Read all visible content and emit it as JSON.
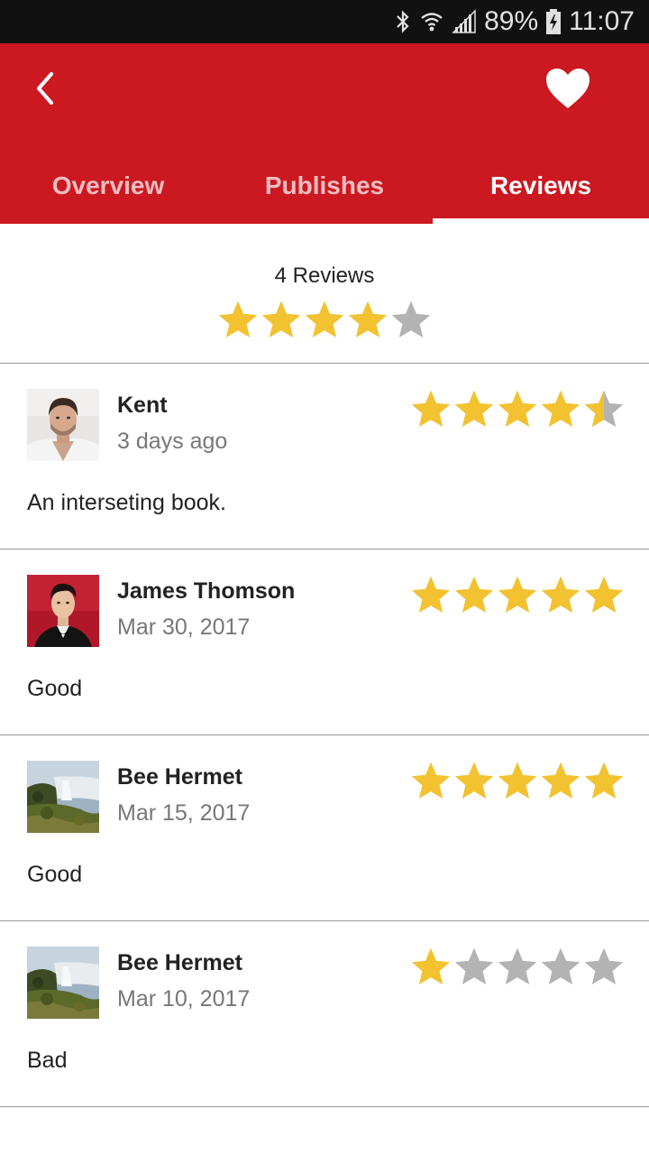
{
  "status_bar": {
    "battery": "89%",
    "time": "11:07"
  },
  "app_bar": {
    "back_icon": "chevron-left-icon",
    "favorite_icon": "heart-icon"
  },
  "tabs": [
    {
      "label": "Overview",
      "active": false
    },
    {
      "label": "Publishes",
      "active": false
    },
    {
      "label": "Reviews",
      "active": true
    }
  ],
  "summary": {
    "count_label": "4 Reviews",
    "rating": 4
  },
  "reviews": [
    {
      "name": "Kent",
      "date": "3 days ago",
      "text": "An interseting book.",
      "rating": 4.5,
      "avatar": "portrait-man"
    },
    {
      "name": "James Thomson",
      "date": "Mar 30, 2017",
      "text": "Good",
      "rating": 5,
      "avatar": "portrait-tuxedo"
    },
    {
      "name": "Bee Hermet",
      "date": "Mar 15, 2017",
      "text": "Good",
      "rating": 5,
      "avatar": "waterfall-landscape"
    },
    {
      "name": "Bee Hermet",
      "date": "Mar 10, 2017",
      "text": "Bad",
      "rating": 1,
      "avatar": "waterfall-landscape"
    }
  ],
  "colors": {
    "primary": "#cc1820",
    "star_filled": "#f2c230",
    "star_empty": "#b3b3b3"
  }
}
